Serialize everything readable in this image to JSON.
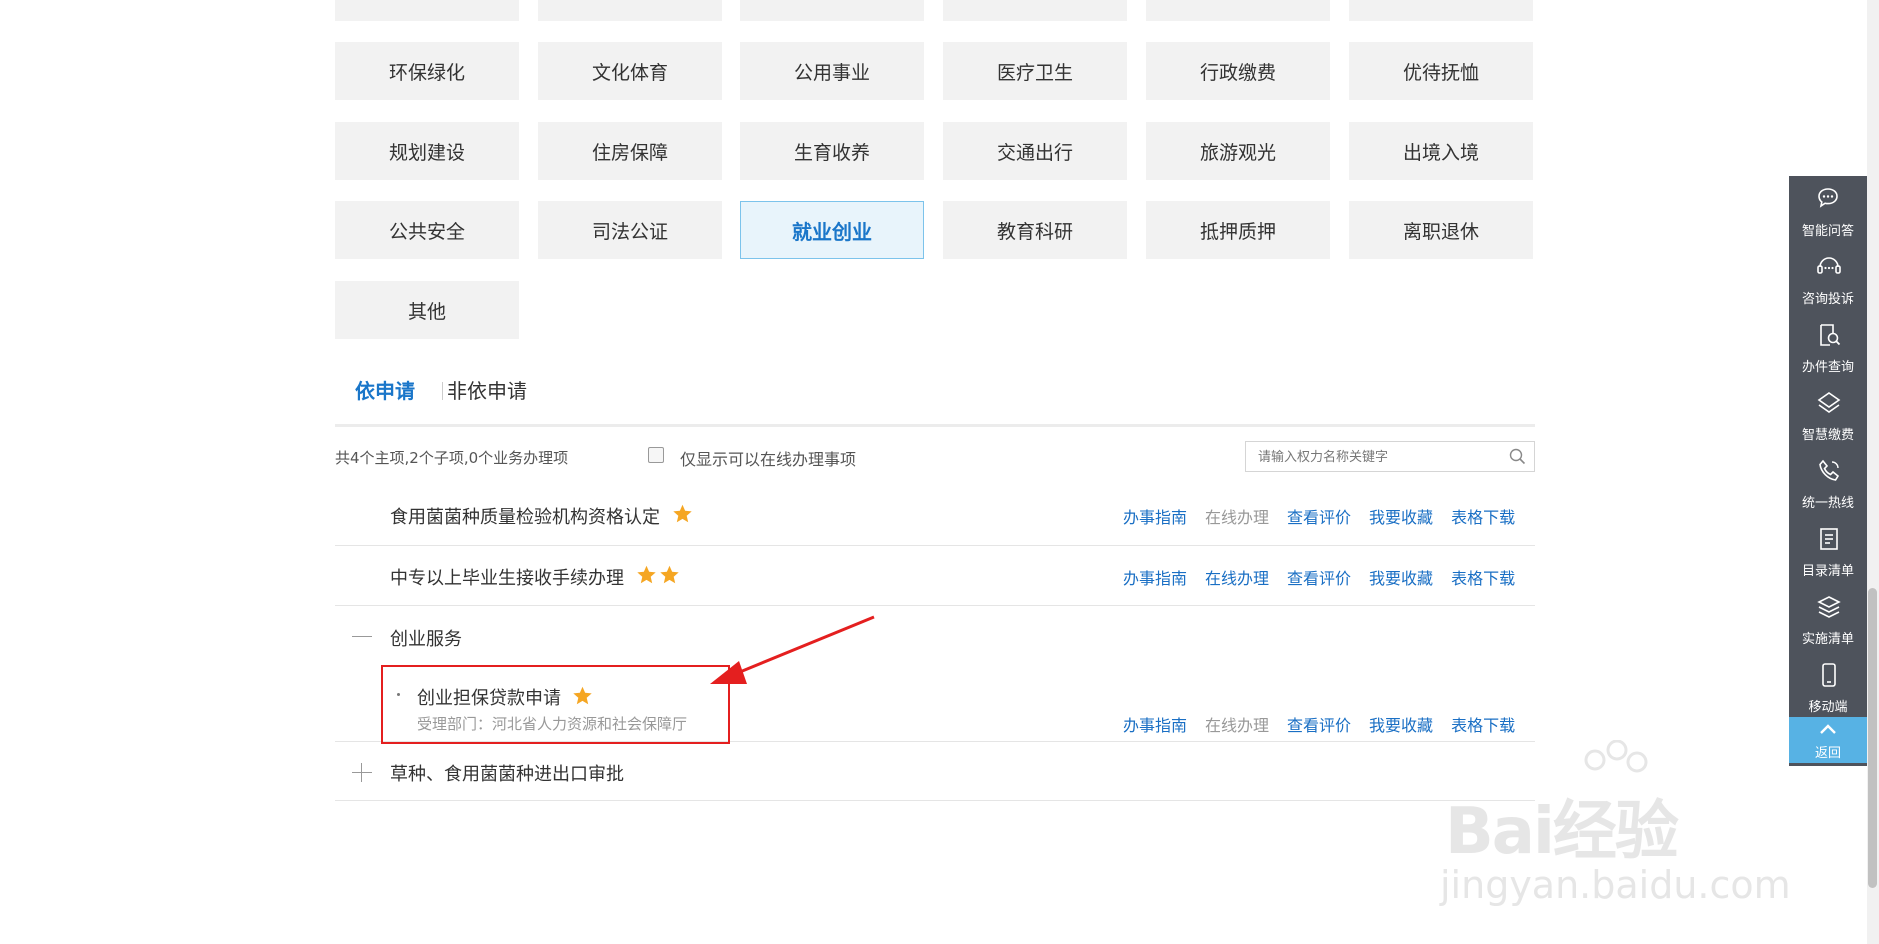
{
  "categories": {
    "rows": [
      [
        "",
        "",
        "",
        "",
        "",
        ""
      ],
      [
        "环保绿化",
        "文化体育",
        "公用事业",
        "医疗卫生",
        "行政缴费",
        "优待抚恤"
      ],
      [
        "规划建设",
        "住房保障",
        "生育收养",
        "交通出行",
        "旅游观光",
        "出境入境"
      ],
      [
        "公共安全",
        "司法公证",
        "就业创业",
        "教育科研",
        "抵押质押",
        "离职退休"
      ],
      [
        "其他"
      ]
    ],
    "active": "就业创业"
  },
  "tabs": {
    "apply": "依申请",
    "non_apply": "非依申请"
  },
  "filter": {
    "summary": "共4个主项,2个子项,0个业务办理项",
    "online_only_label": "仅显示可以在线办理事项",
    "online_only_checked": false,
    "search_placeholder": "请输入权力名称关键字"
  },
  "actions": {
    "guide": "办事指南",
    "online": "在线办理",
    "review": "查看评价",
    "favorite": "我要收藏",
    "download": "表格下载"
  },
  "items": [
    {
      "title": "食用菌菌种质量检验机构资格认定",
      "stars": 1,
      "online_enabled": false
    },
    {
      "title": "中专以上毕业生接收手续办理",
      "stars": 2,
      "online_enabled": true
    }
  ],
  "group": {
    "title": "创业服务",
    "expanded": true,
    "sub_item": {
      "title": "创业担保贷款申请",
      "stars": 1,
      "department": "受理部门：河北省人力资源和社会保障厅",
      "online_enabled": false
    }
  },
  "collapsed_group": {
    "title": "草种、食用菌菌种进出口审批",
    "expanded": false
  },
  "sidebar": {
    "items": [
      {
        "label": "智能问答",
        "icon": "chat-bubble-icon"
      },
      {
        "label": "咨询投诉",
        "icon": "headset-chat-icon"
      },
      {
        "label": "办件查询",
        "icon": "document-search-icon"
      },
      {
        "label": "智慧缴费",
        "icon": "payment-icon"
      },
      {
        "label": "统一热线",
        "icon": "phone-icon"
      },
      {
        "label": "目录清单",
        "icon": "list-document-icon"
      },
      {
        "label": "实施清单",
        "icon": "layers-icon"
      },
      {
        "label": "移动端",
        "icon": "mobile-icon"
      }
    ],
    "back_label": "返回"
  },
  "watermark": {
    "brand": "Bai经验",
    "url": "jingyan.baidu.com"
  },
  "colors": {
    "link": "#1a6fc4",
    "active_bg": "#e8f4fb",
    "active_border": "#7cc3eb",
    "star": "#f5a623",
    "highlight": "#e41f1f",
    "sidebar_bg": "#4e535c",
    "back_bg": "#57b2e4"
  }
}
